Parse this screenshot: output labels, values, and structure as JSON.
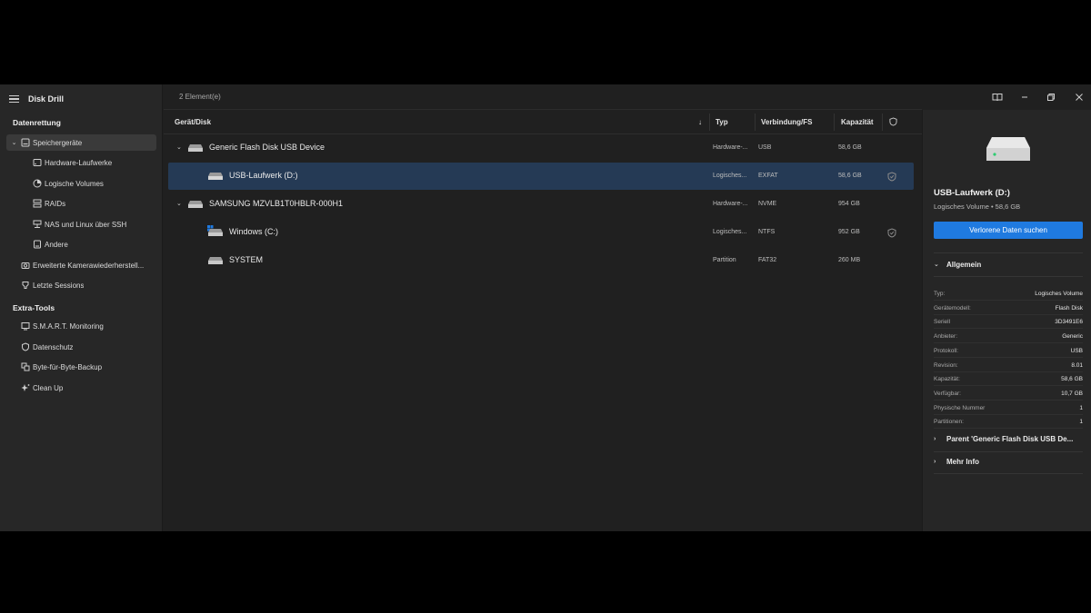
{
  "app": {
    "title": "Disk Drill"
  },
  "sidebar": {
    "section_recovery": "Datenrettung",
    "storage": "Speichergeräte",
    "items": [
      {
        "label": "Hardware-Laufwerke",
        "icon": "hard-drive-icon"
      },
      {
        "label": "Logische Volumes",
        "icon": "pie-icon"
      },
      {
        "label": "RAIDs",
        "icon": "raid-icon"
      },
      {
        "label": "NAS und Linux über SSH",
        "icon": "nas-icon"
      },
      {
        "label": "Andere",
        "icon": "drive-icon"
      }
    ],
    "camera": "Erweiterte Kamerawiederherstell...",
    "sessions": "Letzte Sessions",
    "section_tools": "Extra-Tools",
    "tools": [
      {
        "label": "S.M.A.R.T. Monitoring",
        "icon": "monitor-icon"
      },
      {
        "label": "Datenschutz",
        "icon": "shield-icon"
      },
      {
        "label": "Byte-für-Byte-Backup",
        "icon": "backup-icon"
      },
      {
        "label": "Clean Up",
        "icon": "sparkle-icon"
      }
    ]
  },
  "main": {
    "count": "2 Element(e)",
    "columns": {
      "device": "Gerät/Disk",
      "sort_icon": "↓",
      "type": "Typ",
      "connection": "Verbindung/FS",
      "capacity": "Kapazität"
    },
    "rows": [
      {
        "name": "Generic Flash Disk USB Device",
        "type": "Hardware-...",
        "conn": "USB",
        "cap": "58,6 GB",
        "level": 0,
        "expanded": true,
        "shield": false
      },
      {
        "name": "USB-Laufwerk (D:)",
        "type": "Logisches...",
        "conn": "EXFAT",
        "cap": "58,6 GB",
        "level": 1,
        "selected": true,
        "shield": true
      },
      {
        "name": "SAMSUNG MZVLB1T0HBLR-000H1",
        "type": "Hardware-...",
        "conn": "NVME",
        "cap": "954 GB",
        "level": 0,
        "expanded": true,
        "shield": false
      },
      {
        "name": "Windows (C:)",
        "type": "Logisches...",
        "conn": "NTFS",
        "cap": "952 GB",
        "level": 1,
        "shield": true,
        "windows": true
      },
      {
        "name": "SYSTEM",
        "type": "Partition",
        "conn": "FAT32",
        "cap": "260 MB",
        "level": 1,
        "shield": false
      }
    ]
  },
  "panel": {
    "title": "USB-Laufwerk (D:)",
    "subtitle": "Logisches Volume • 58,6 GB",
    "action": "Verlorene Daten suchen",
    "general": "Allgemein",
    "props": [
      {
        "k": "Typ:",
        "v": "Logisches Volume"
      },
      {
        "k": "Gerätemodell:",
        "v": "Flash Disk"
      },
      {
        "k": "Seriell",
        "v": "3D3491E6"
      },
      {
        "k": "Anbieter:",
        "v": "Generic"
      },
      {
        "k": "Protokoll:",
        "v": "USB"
      },
      {
        "k": "Revision:",
        "v": "8.01"
      },
      {
        "k": "Kapazität:",
        "v": "58,6 GB"
      },
      {
        "k": "Verfügbar:",
        "v": "10,7 GB"
      },
      {
        "k": "Physische Nummer",
        "v": "1"
      },
      {
        "k": "Partitionen:",
        "v": "1"
      }
    ],
    "parent": "Parent 'Generic Flash Disk USB De...",
    "more": "Mehr Info"
  },
  "colors": {
    "accent": "#1f7ae0",
    "selection": "#253a55"
  }
}
